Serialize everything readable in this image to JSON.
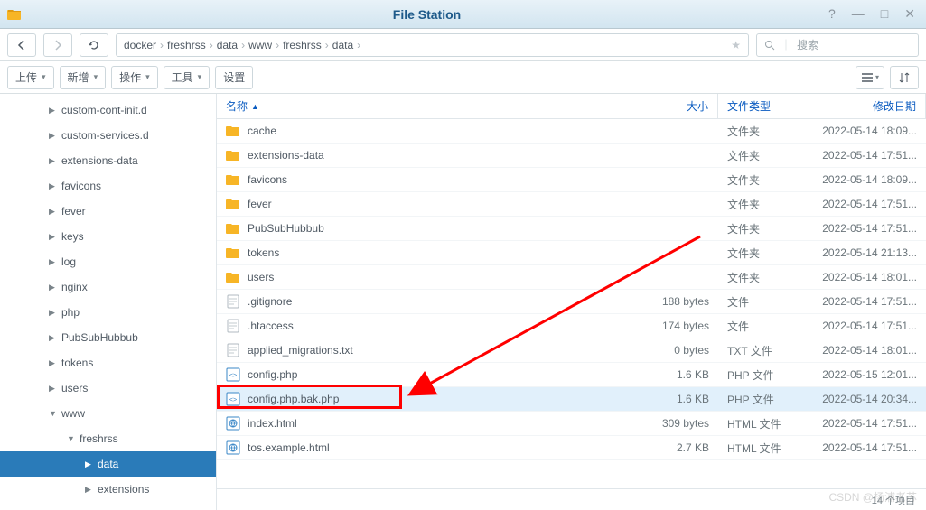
{
  "app": {
    "title": "File Station"
  },
  "nav": {
    "crumbs": [
      "docker",
      "freshrss",
      "data",
      "www",
      "freshrss",
      "data"
    ]
  },
  "search": {
    "placeholder": "搜索"
  },
  "toolbar": {
    "upload": "上传",
    "create": "新增",
    "action": "操作",
    "tool": "工具",
    "settings": "设置"
  },
  "tree": [
    {
      "label": "custom-cont-init.d",
      "depth": 1,
      "collapsed": true
    },
    {
      "label": "custom-services.d",
      "depth": 1,
      "collapsed": true
    },
    {
      "label": "extensions-data",
      "depth": 1,
      "collapsed": true
    },
    {
      "label": "favicons",
      "depth": 1,
      "collapsed": true
    },
    {
      "label": "fever",
      "depth": 1,
      "collapsed": true
    },
    {
      "label": "keys",
      "depth": 1,
      "collapsed": true
    },
    {
      "label": "log",
      "depth": 1,
      "collapsed": true
    },
    {
      "label": "nginx",
      "depth": 1,
      "collapsed": true
    },
    {
      "label": "php",
      "depth": 1,
      "collapsed": true
    },
    {
      "label": "PubSubHubbub",
      "depth": 1,
      "collapsed": true
    },
    {
      "label": "tokens",
      "depth": 1,
      "collapsed": true
    },
    {
      "label": "users",
      "depth": 1,
      "collapsed": true
    },
    {
      "label": "www",
      "depth": 1,
      "collapsed": false
    },
    {
      "label": "freshrss",
      "depth": 2,
      "collapsed": false
    },
    {
      "label": "data",
      "depth": 3,
      "collapsed": true,
      "selected": true
    },
    {
      "label": "extensions",
      "depth": 3,
      "collapsed": true
    }
  ],
  "columns": {
    "name": "名称",
    "size": "大小",
    "type": "文件类型",
    "modified": "修改日期"
  },
  "files": [
    {
      "name": "cache",
      "icon": "folder",
      "size": "",
      "type": "文件夹",
      "date": "2022-05-14 18:09..."
    },
    {
      "name": "extensions-data",
      "icon": "folder",
      "size": "",
      "type": "文件夹",
      "date": "2022-05-14 17:51..."
    },
    {
      "name": "favicons",
      "icon": "folder",
      "size": "",
      "type": "文件夹",
      "date": "2022-05-14 18:09..."
    },
    {
      "name": "fever",
      "icon": "folder",
      "size": "",
      "type": "文件夹",
      "date": "2022-05-14 17:51..."
    },
    {
      "name": "PubSubHubbub",
      "icon": "folder",
      "size": "",
      "type": "文件夹",
      "date": "2022-05-14 17:51..."
    },
    {
      "name": "tokens",
      "icon": "folder",
      "size": "",
      "type": "文件夹",
      "date": "2022-05-14 21:13..."
    },
    {
      "name": "users",
      "icon": "folder",
      "size": "",
      "type": "文件夹",
      "date": "2022-05-14 18:01..."
    },
    {
      "name": ".gitignore",
      "icon": "text",
      "size": "188 bytes",
      "type": "文件",
      "date": "2022-05-14 17:51..."
    },
    {
      "name": ".htaccess",
      "icon": "text",
      "size": "174 bytes",
      "type": "文件",
      "date": "2022-05-14 17:51..."
    },
    {
      "name": "applied_migrations.txt",
      "icon": "text",
      "size": "0 bytes",
      "type": "TXT 文件",
      "date": "2022-05-14 18:01..."
    },
    {
      "name": "config.php",
      "icon": "php",
      "size": "1.6 KB",
      "type": "PHP 文件",
      "date": "2022-05-15 12:01..."
    },
    {
      "name": "config.php.bak.php",
      "icon": "php",
      "size": "1.6 KB",
      "type": "PHP 文件",
      "date": "2022-05-14 20:34...",
      "selected": true
    },
    {
      "name": "index.html",
      "icon": "html",
      "size": "309 bytes",
      "type": "HTML 文件",
      "date": "2022-05-14 17:51..."
    },
    {
      "name": "tos.example.html",
      "icon": "html",
      "size": "2.7 KB",
      "type": "HTML 文件",
      "date": "2022-05-14 17:51..."
    }
  ],
  "footer": {
    "count": "14 个项目"
  },
  "watermark": "CSDN @杨浦老苏"
}
